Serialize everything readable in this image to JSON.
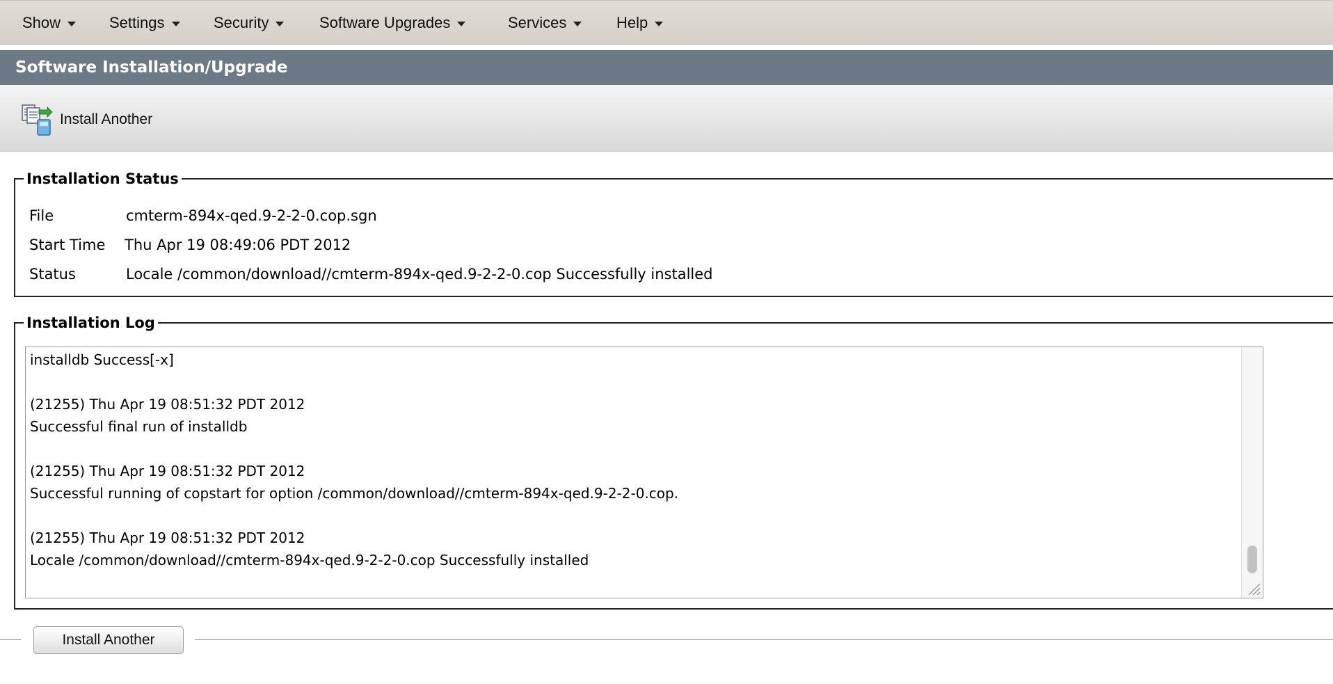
{
  "menu": [
    {
      "label": "Show"
    },
    {
      "label": "Settings"
    },
    {
      "label": "Security"
    },
    {
      "label": "Software Upgrades"
    },
    {
      "label": "Services"
    },
    {
      "label": "Help"
    }
  ],
  "page_title": "Software Installation/Upgrade",
  "toolbar": {
    "install_another_label": "Install Another",
    "icon": "install-another-icon"
  },
  "installation_status": {
    "legend": "Installation Status",
    "rows": [
      {
        "label": "File",
        "value": "cmterm-894x-qed.9-2-2-0.cop.sgn"
      },
      {
        "label": "Start Time",
        "value": "Thu Apr 19 08:49:06 PDT 2012"
      },
      {
        "label": "Status",
        "value": "Locale /common/download//cmterm-894x-qed.9-2-2-0.cop Successfully installed"
      }
    ]
  },
  "installation_log": {
    "legend": "Installation Log",
    "text": "installdb Success[-x]\n\n(21255) Thu Apr 19 08:51:32 PDT 2012\nSuccessful final run of installdb\n\n(21255) Thu Apr 19 08:51:32 PDT 2012\nSuccessful running of copstart for option /common/download//cmterm-894x-qed.9-2-2-0.cop.\n\n(21255) Thu Apr 19 08:51:32 PDT 2012\nLocale /common/download//cmterm-894x-qed.9-2-2-0.cop Successfully installed"
  },
  "footer": {
    "install_another_label": "Install Another"
  },
  "colors": {
    "title_bar": "#6c7a88",
    "menu_bar": "#d9d4ce",
    "bottom_rule": "#5e8b8b"
  }
}
